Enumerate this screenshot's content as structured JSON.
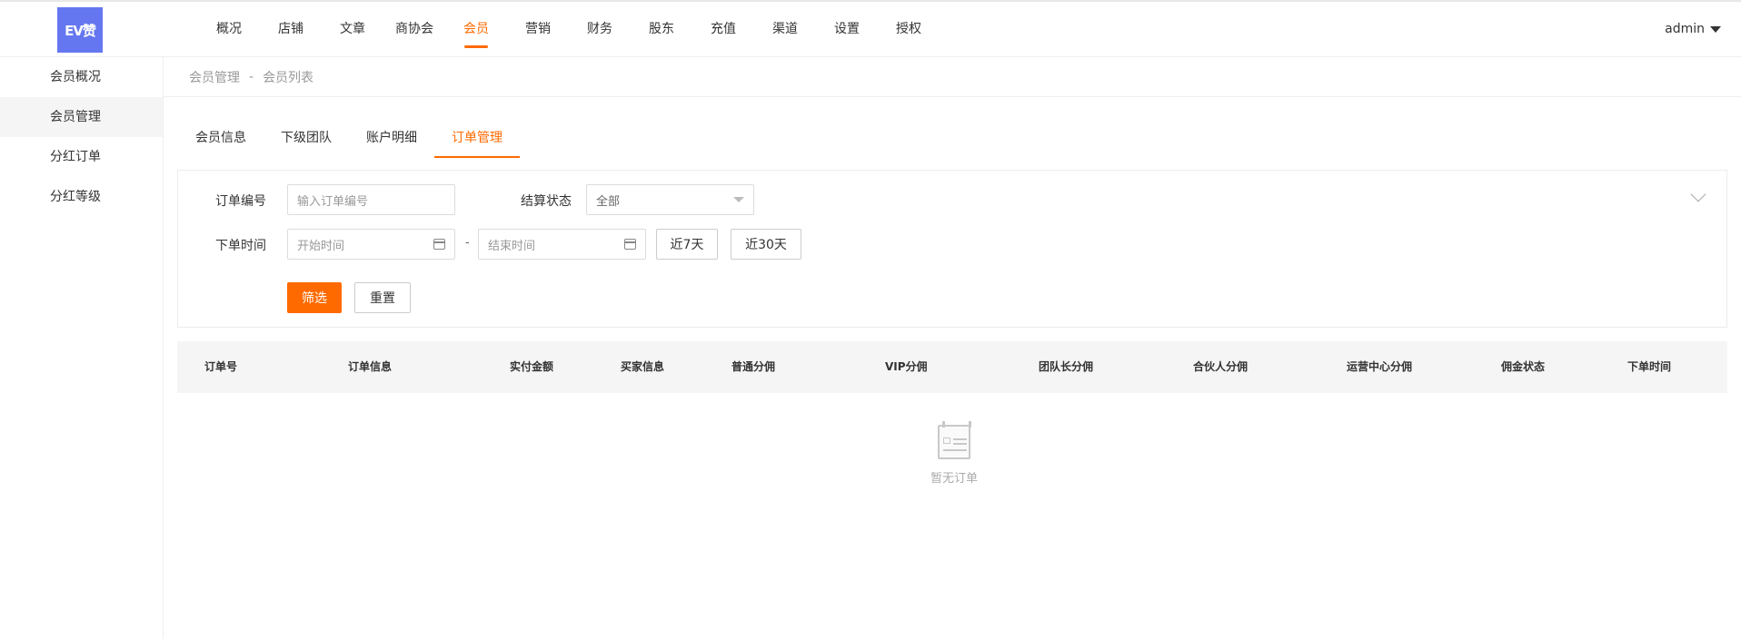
{
  "app": {
    "logo_text": "EV赞",
    "user": "admin"
  },
  "nav": {
    "items": [
      "概况",
      "店铺",
      "文章",
      "商协会",
      "会员",
      "营销",
      "财务",
      "股东",
      "充值",
      "渠道",
      "设置",
      "授权"
    ],
    "active": "会员"
  },
  "sidebar": {
    "items": [
      "会员概况",
      "会员管理",
      "分红订单",
      "分红等级"
    ],
    "active": "会员管理"
  },
  "breadcrumb": {
    "parent": "会员管理",
    "separator": "-",
    "current": "会员列表"
  },
  "tabs": {
    "items": [
      "会员信息",
      "下级团队",
      "账户明细",
      "订单管理"
    ],
    "active": "订单管理"
  },
  "filter": {
    "order_no_label": "订单编号",
    "order_no_placeholder": "输入订单编号",
    "status_label": "结算状态",
    "status_value": "全部",
    "time_label": "下单时间",
    "start_placeholder": "开始时间",
    "range_separator": "-",
    "end_placeholder": "结束时间",
    "recent7": "近7天",
    "recent30": "近30天",
    "filter_button": "筛选",
    "reset_button": "重置"
  },
  "table": {
    "columns": [
      "订单号",
      "订单信息",
      "实付金额",
      "买家信息",
      "普通分佣",
      "VIP分佣",
      "团队长分佣",
      "合伙人分佣",
      "运营中心分佣",
      "佣金状态",
      "下单时间"
    ],
    "rows": [],
    "empty_text": "暂无订单"
  },
  "colors": {
    "accent": "#ff6a00",
    "logo_bg": "#6577f0"
  }
}
